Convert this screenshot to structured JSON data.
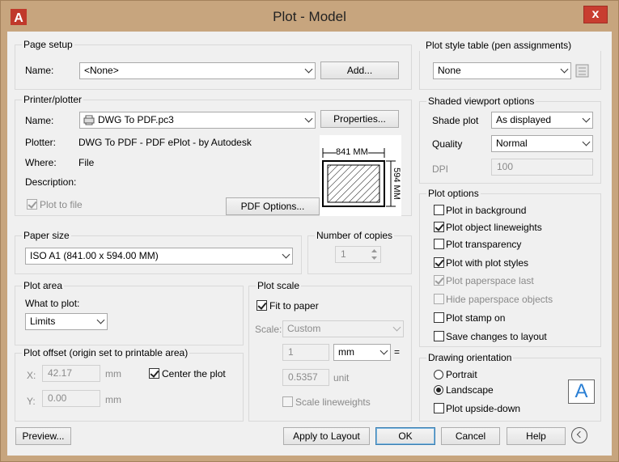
{
  "window": {
    "title": "Plot - Model",
    "close_glyph": "x"
  },
  "page_setup": {
    "title": "Page setup",
    "name_label": "Name:",
    "name_value": "<None>",
    "add_button": "Add..."
  },
  "printer": {
    "title": "Printer/plotter",
    "name_label": "Name:",
    "name_value": "DWG To PDF.pc3",
    "properties_button": "Properties...",
    "plotter_label": "Plotter:",
    "plotter_value": "DWG To PDF - PDF ePlot - by Autodesk",
    "where_label": "Where:",
    "where_value": "File",
    "description_label": "Description:",
    "plot_to_file": "Plot to file",
    "pdf_options_button": "PDF Options...",
    "preview_width": "841 MM",
    "preview_height": "594 MM"
  },
  "paper_size": {
    "title": "Paper size",
    "value": "ISO A1 (841.00 x 594.00 MM)"
  },
  "copies": {
    "title": "Number of copies",
    "value": "1"
  },
  "plot_area": {
    "title": "Plot area",
    "what_label": "What to plot:",
    "what_value": "Limits"
  },
  "plot_offset": {
    "title": "Plot offset (origin set to printable area)",
    "x_label": "X:",
    "x_value": "42.17",
    "x_unit": "mm",
    "y_label": "Y:",
    "y_value": "0.00",
    "y_unit": "mm",
    "center_label": "Center the plot"
  },
  "plot_scale": {
    "title": "Plot scale",
    "fit_label": "Fit to paper",
    "scale_label": "Scale:",
    "scale_value": "Custom",
    "value1": "1",
    "unit_value": "mm",
    "equals": "=",
    "value2": "0.5357",
    "unit_label": "unit",
    "lineweights_label": "Scale lineweights"
  },
  "plot_style": {
    "title": "Plot style table (pen assignments)",
    "value": "None"
  },
  "shaded": {
    "title": "Shaded viewport options",
    "shade_label": "Shade plot",
    "shade_value": "As displayed",
    "quality_label": "Quality",
    "quality_value": "Normal",
    "dpi_label": "DPI",
    "dpi_value": "100"
  },
  "plot_options": {
    "title": "Plot options",
    "items": [
      "Plot in background",
      "Plot object lineweights",
      "Plot transparency",
      "Plot with plot styles",
      "Plot paperspace last",
      "Hide paperspace objects",
      "Plot stamp on",
      "Save changes to layout"
    ]
  },
  "orientation": {
    "title": "Drawing orientation",
    "portrait": "Portrait",
    "landscape": "Landscape",
    "upside_down": "Plot upside-down",
    "icon_letter": "A"
  },
  "footer": {
    "preview": "Preview...",
    "apply": "Apply to Layout",
    "ok": "OK",
    "cancel": "Cancel",
    "help": "Help"
  },
  "colors": {
    "frame": "#c7a57e",
    "close": "#c83d30",
    "ok_border": "#3c7fb1",
    "orientation_icon": "#2a7fd4"
  }
}
